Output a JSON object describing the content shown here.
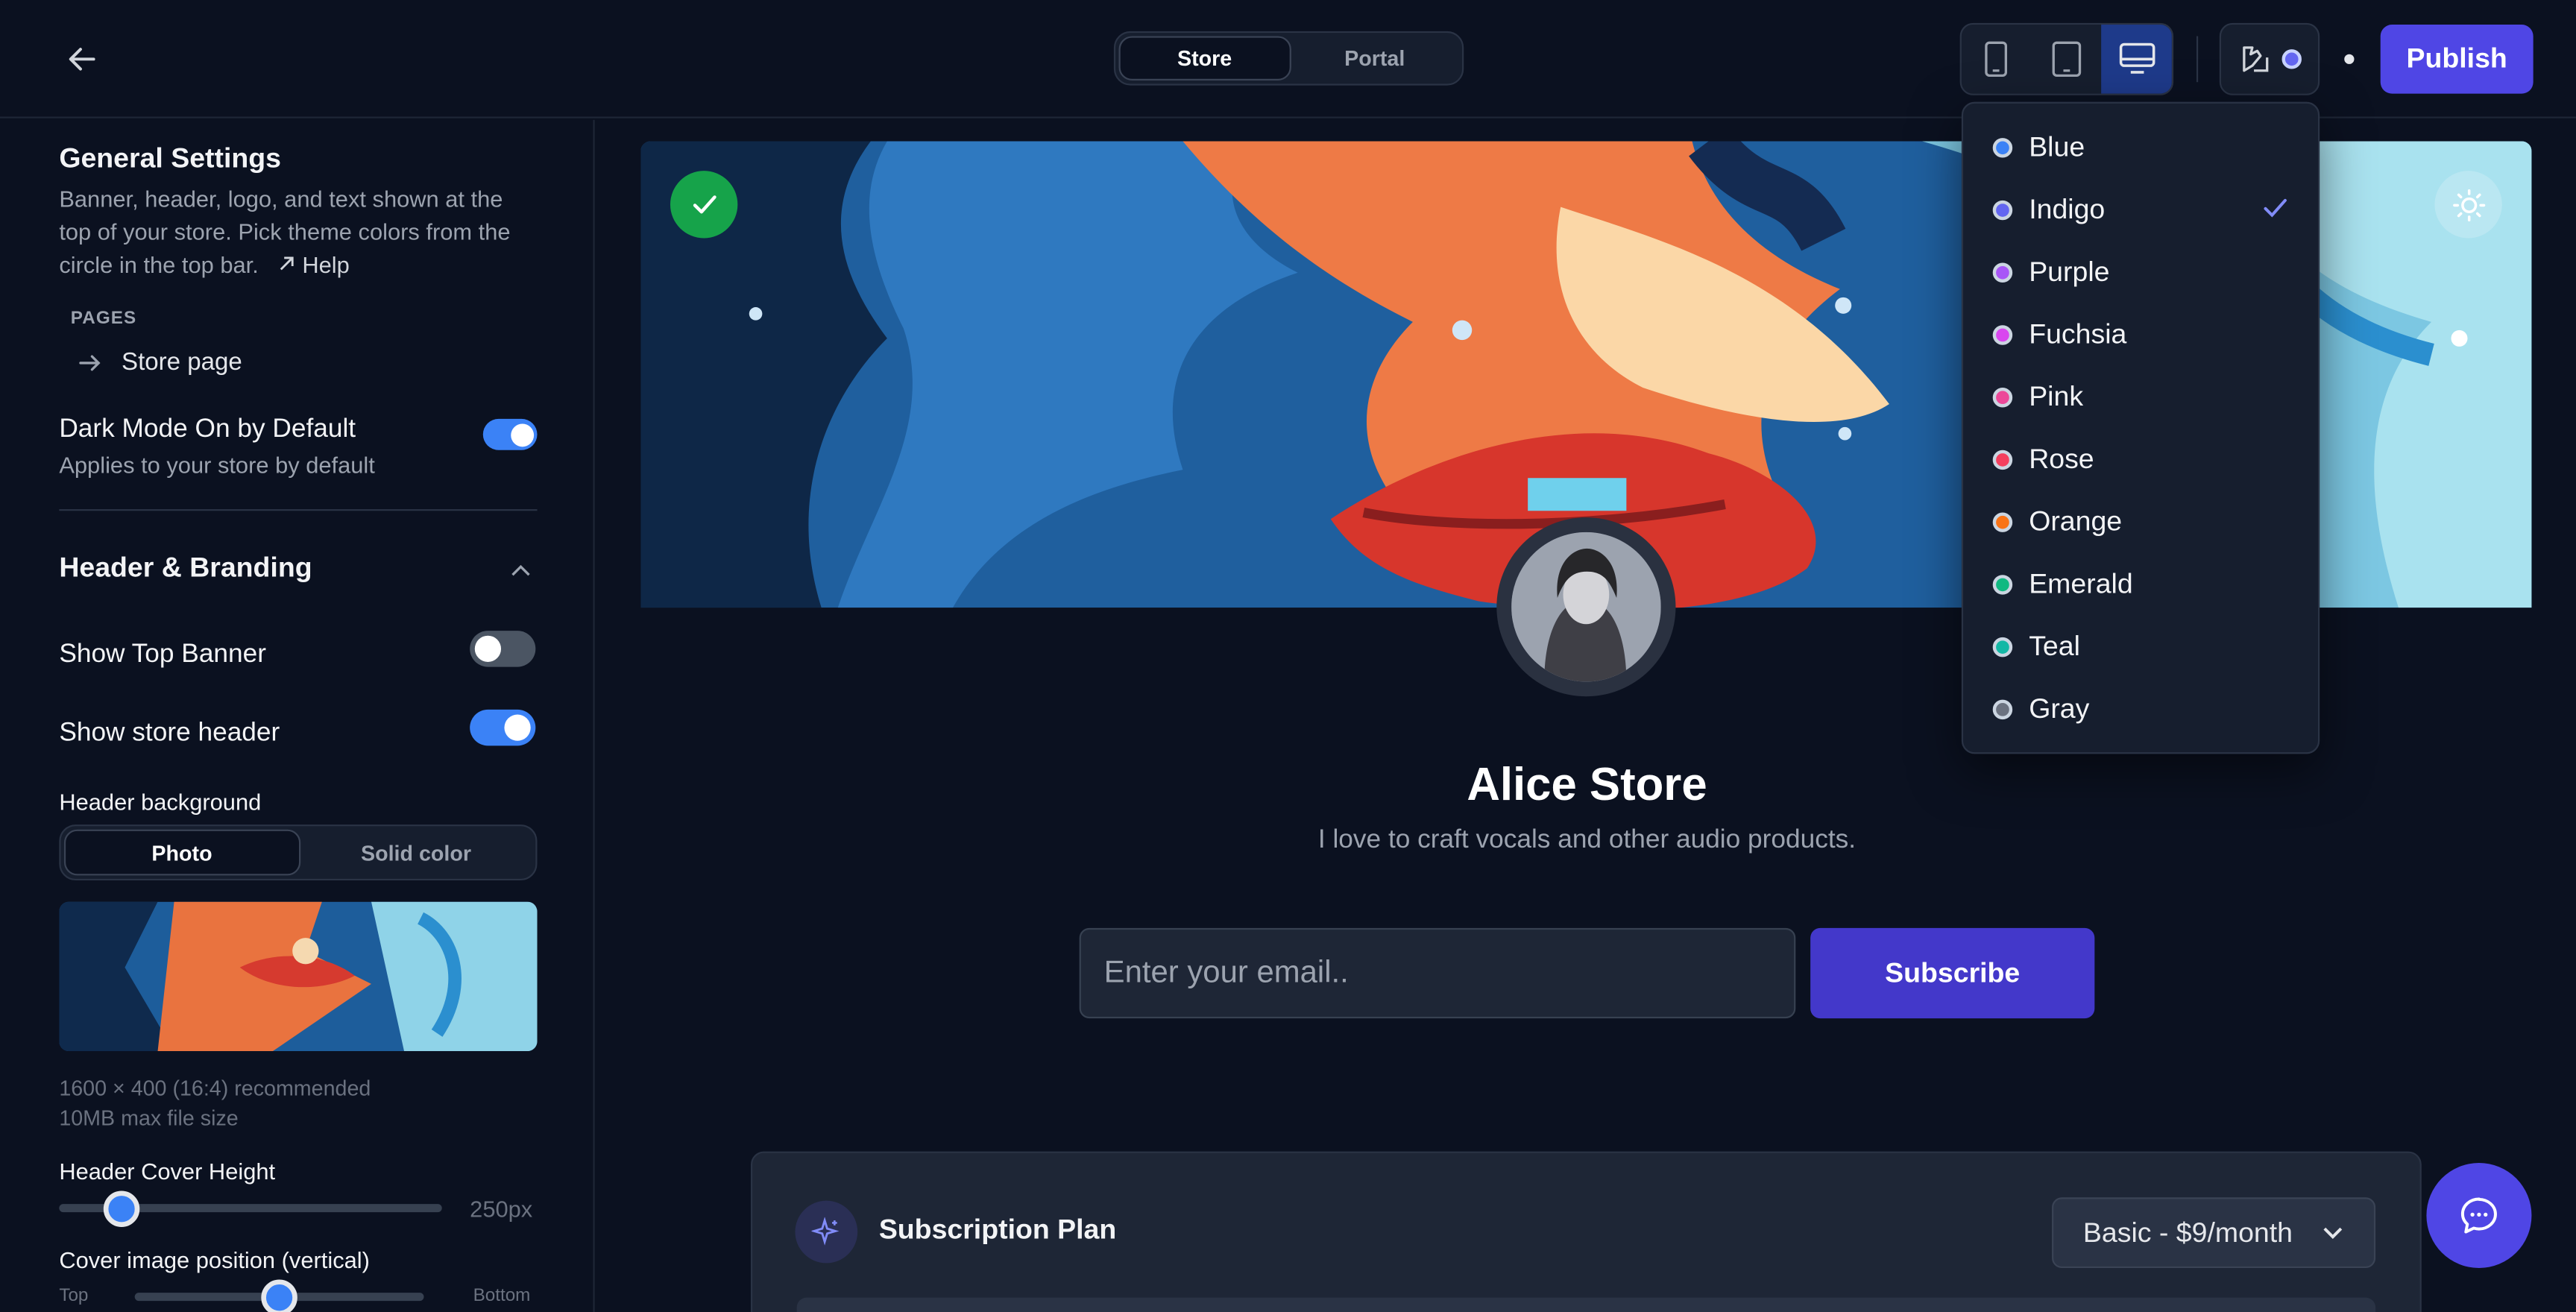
{
  "topbar": {
    "mode_tabs": [
      "Store",
      "Portal"
    ],
    "active_mode": "Store",
    "publish_label": "Publish"
  },
  "sidebar": {
    "general_title": "General Settings",
    "general_desc": "Banner, header, logo, and text shown at the top of your store. Pick theme colors from the circle in the top bar.",
    "help_label": "Help",
    "pages_label": "PAGES",
    "store_page_label": "Store page",
    "dark_mode": {
      "label": "Dark Mode On by Default",
      "sub": "Applies to your store by default",
      "on": true
    },
    "header_branding_title": "Header & Branding",
    "show_top_banner": {
      "label": "Show Top Banner",
      "on": false
    },
    "show_store_header": {
      "label": "Show store header",
      "on": true
    },
    "header_background_label": "Header background",
    "bg_options": [
      "Photo",
      "Solid color"
    ],
    "bg_selected": "Photo",
    "image_hint_1": "1600 × 400 (16:4) recommended",
    "image_hint_2": "10MB max file size",
    "cover_height_label": "Header Cover Height",
    "cover_height_value": "250px",
    "cover_position_label": "Cover image position (vertical)",
    "pos_top": "Top",
    "pos_bottom": "Bottom",
    "cover_height_level": 0.16,
    "cover_position_level": 0.5
  },
  "store": {
    "name": "Alice Store",
    "bio": "I love to craft vocals and other audio products.",
    "email_placeholder": "Enter your email..",
    "subscribe_label": "Subscribe",
    "plan_title": "Subscription Plan",
    "plan_selected": "Basic - $9/month"
  },
  "theme_dropdown": {
    "selected": "Indigo",
    "options": [
      {
        "label": "Blue",
        "color": "#3b82f6"
      },
      {
        "label": "Indigo",
        "color": "#6366f1"
      },
      {
        "label": "Purple",
        "color": "#a855f7"
      },
      {
        "label": "Fuchsia",
        "color": "#d946ef"
      },
      {
        "label": "Pink",
        "color": "#ec4899"
      },
      {
        "label": "Rose",
        "color": "#f43f5e"
      },
      {
        "label": "Orange",
        "color": "#f97316"
      },
      {
        "label": "Emerald",
        "color": "#10b981"
      },
      {
        "label": "Teal",
        "color": "#14b8a6"
      },
      {
        "label": "Gray",
        "color": "#6b7280"
      }
    ]
  },
  "colors": {
    "accent": "#4f46e5",
    "toggle_on": "#3b82f6",
    "success": "#16a34a"
  }
}
